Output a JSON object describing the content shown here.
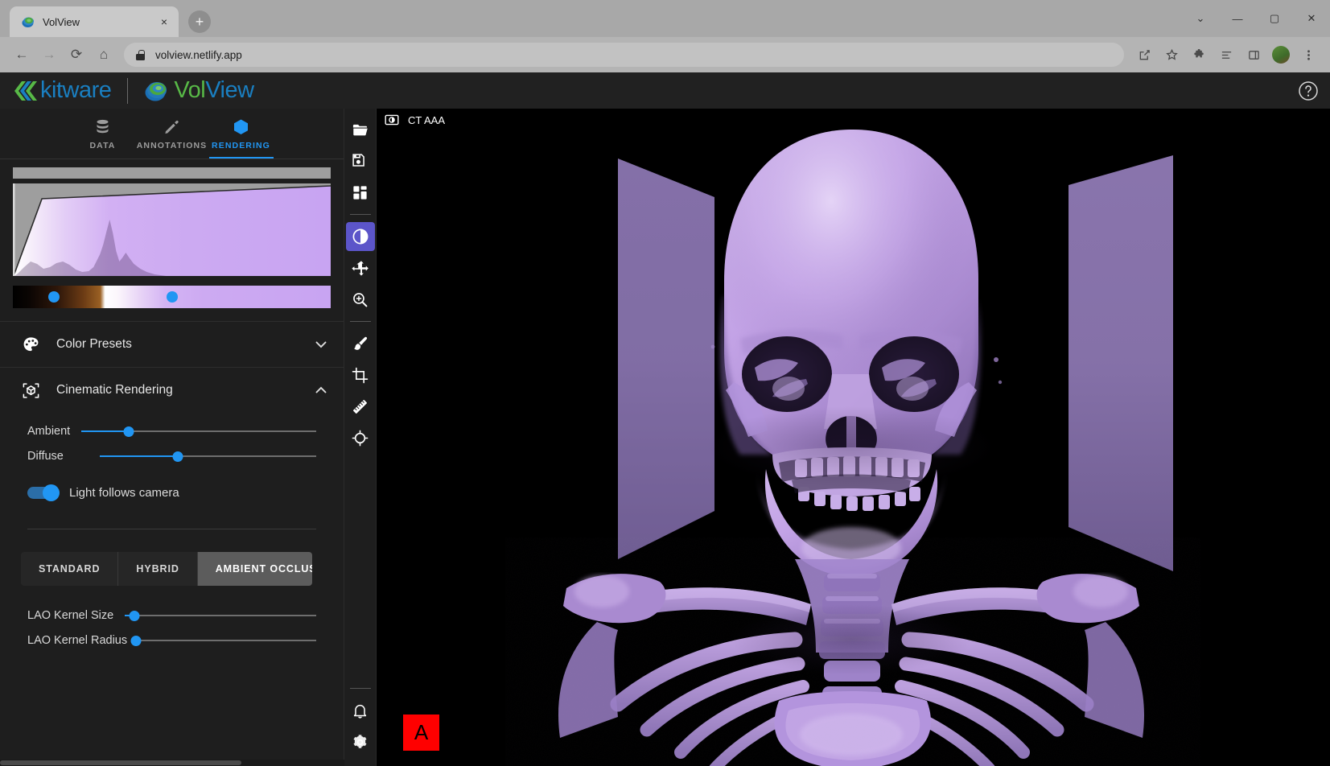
{
  "browser": {
    "tab": {
      "title": "VolView",
      "favicon": "volview-favicon-icon",
      "close": "×"
    },
    "new_tab": "+",
    "window_controls": {
      "minimize": "—",
      "maximize": "▢",
      "close": "✕",
      "restore": "⌄"
    },
    "nav": {
      "back": "←",
      "forward": "→",
      "reload": "⟳",
      "home": "⌂"
    },
    "url": "volview.netlify.app",
    "omnibox_icons": [
      "share-icon",
      "bookmark-star-icon",
      "extensions-puzzle-icon",
      "reading-list-icon",
      "split-view-icon",
      "profile-avatar",
      "chrome-menu-icon"
    ]
  },
  "app": {
    "brand_kitware": "kitware",
    "brand_vol": "Vol",
    "brand_view": "View",
    "help_label": "?",
    "accent_blue": "#2196f3",
    "accent_purple": "#5c55c9"
  },
  "panel": {
    "tabs": [
      {
        "label": "DATA",
        "icon": "database-icon",
        "active": false
      },
      {
        "label": "ANNOTATIONS",
        "icon": "pencil-icon",
        "active": false
      },
      {
        "label": "RENDERING",
        "icon": "cube-icon",
        "active": true
      }
    ],
    "transfer_function": {
      "name": "opacity-transfer-function",
      "colormap_stops": [
        "#000000",
        "#6a3a14",
        "#9a6023",
        "#ffffff",
        "#d4b4f4",
        "#c8a4f2"
      ],
      "handles": [
        {
          "name": "colormap-handle-low",
          "position_pct": 13
        },
        {
          "name": "colormap-handle-high",
          "position_pct": 50
        }
      ]
    },
    "sections": [
      {
        "title": "Color Presets",
        "icon": "palette-icon",
        "expanded": false,
        "chevron": "▾"
      },
      {
        "title": "Cinematic Rendering",
        "icon": "cinematic-cube-icon",
        "expanded": true,
        "chevron": "▴"
      }
    ],
    "cinematic": {
      "sliders": [
        {
          "label": "Ambient",
          "value_pct": 20
        },
        {
          "label": "Diffuse",
          "value_pct": 36
        }
      ],
      "light_follows_camera": {
        "label": "Light follows camera",
        "on": true
      },
      "modes": [
        {
          "label": "STANDARD",
          "active": false
        },
        {
          "label": "HYBRID",
          "active": false
        },
        {
          "label": "AMBIENT OCCLUSION",
          "active": true
        }
      ],
      "lao_sliders": [
        {
          "label": "LAO Kernel Size",
          "value_pct": 5
        },
        {
          "label": "LAO Kernel Radius",
          "value_pct": 1
        }
      ]
    }
  },
  "toolbar": {
    "items": [
      {
        "name": "open-files-button",
        "icon": "folder-open-icon",
        "active": false
      },
      {
        "name": "save-session-button",
        "icon": "save-disk-icon",
        "active": false
      },
      {
        "name": "layout-button",
        "icon": "grid-layout-icon",
        "active": false
      },
      {
        "name": "divider-1",
        "icon": "divider",
        "active": false
      },
      {
        "name": "window-level-button",
        "icon": "contrast-circle-icon",
        "active": true
      },
      {
        "name": "pan-button",
        "icon": "move-arrows-icon",
        "active": false
      },
      {
        "name": "zoom-button",
        "icon": "magnifier-plus-icon",
        "active": false
      },
      {
        "name": "divider-2",
        "icon": "divider",
        "active": false
      },
      {
        "name": "paint-button",
        "icon": "paintbrush-icon",
        "active": false
      },
      {
        "name": "crop-button",
        "icon": "crop-icon",
        "active": false
      },
      {
        "name": "ruler-button",
        "icon": "ruler-icon",
        "active": false
      },
      {
        "name": "polygon-button",
        "icon": "polygon-target-icon",
        "active": false
      }
    ],
    "bottom": [
      {
        "name": "notifications-button",
        "icon": "bell-icon"
      },
      {
        "name": "settings-button",
        "icon": "gear-icon"
      }
    ]
  },
  "viewport": {
    "title": "CT AAA",
    "camera_icon": "screenshot-camera-icon",
    "orientation_badge": "A",
    "orientation_badge_color": "#ff0000",
    "volume_name": "ct-skull-volume-rendering"
  }
}
